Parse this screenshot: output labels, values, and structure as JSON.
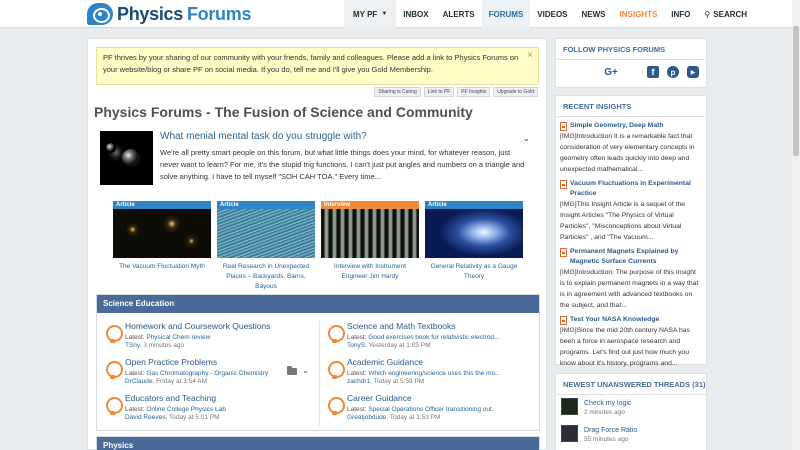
{
  "header": {
    "logo": {
      "part1": "Physics",
      "part2": "Forums"
    },
    "nav": [
      {
        "label": "MY PF",
        "id": "mypf"
      },
      {
        "label": "INBOX",
        "id": "inbox"
      },
      {
        "label": "ALERTS",
        "id": "alerts"
      },
      {
        "label": "FORUMS",
        "id": "forums"
      },
      {
        "label": "VIDEOS",
        "id": "videos"
      },
      {
        "label": "NEWS",
        "id": "news"
      },
      {
        "label": "INSIGHTS",
        "id": "insights"
      },
      {
        "label": "INFO",
        "id": "info"
      },
      {
        "label": "SEARCH",
        "id": "search"
      }
    ],
    "accent_insights": "#f0893a",
    "accent_forums": "#2d6fa5"
  },
  "notice": {
    "text": "PF thrives by your sharing of our community with your friends, family and colleagues. Please add a link to Physics Forums on your website/blog or share PF on social media. If you do, tell me and I'll give you Gold Membership.",
    "close": "×",
    "links": [
      "Sharing is Caring",
      "Link to PF",
      "PF Insights",
      "Upgrade to Gold"
    ]
  },
  "page_title": "Physics Forums - The Fusion of Science and Community",
  "featured_post": {
    "title": "What menial mental task do you struggle with?",
    "text": "We're all pretty smart people on this forum, but what little things does your mind, for whatever reason, just never want to learn? For me, it's the stupid trig functions. I can't just put angles and numbers on a triangle and solve anything. I have to tell myself \"SOH CAH TOA.\" Every time..."
  },
  "articles": [
    {
      "tag": "Article",
      "caption": "The Vacuum Fluctuation Myth"
    },
    {
      "tag": "Article",
      "caption": "Real Research in Unexpected Places – Backyards, Barns, Bayous"
    },
    {
      "tag": "Interview",
      "caption": "Interview with Instrument Engineer Jim Hardy"
    },
    {
      "tag": "Article",
      "caption": "General Relativity as a Gauge Theory"
    }
  ],
  "sections": [
    {
      "title": "Science Education",
      "forums": [
        {
          "title": "Homework and Coursework Questions",
          "latest_label": "Latest:",
          "latest": "Physical Chem review",
          "user": "TSny",
          "time": ", 3 minutes ago"
        },
        {
          "title": "Open Practice Problems",
          "latest_label": "Latest:",
          "latest": "Gas Chromatography - Organic Chemistry",
          "user": "DrClaude",
          "time": ", Friday at 3:54 AM"
        },
        {
          "title": "Educators and Teaching",
          "latest_label": "Latest:",
          "latest": "Online College Physics Lab",
          "user": "David Reeves",
          "time": ", Today at 5:01 PM"
        },
        {
          "title": "Science and Math Textbooks",
          "latest_label": "Latest:",
          "latest": "Good exercises book for relativistic electrod...",
          "user": "TonyS",
          "time": ", Yesterday at 1:03 PM"
        },
        {
          "title": "Academic Guidance",
          "latest_label": "Latest:",
          "latest": "Which engineering/science uses this the mo...",
          "user": "zachdr1",
          "time": ", Today at 5:59 PM"
        },
        {
          "title": "Career Guidance",
          "latest_label": "Latest:",
          "latest": "Special Operations Officer transitioning out.",
          "user": "Greatjobdude",
          "time": ", Today at 1:53 PM"
        }
      ]
    },
    {
      "title": "Physics"
    }
  ],
  "sidebar": {
    "follow": {
      "title": "FOLLOW PHYSICS FORUMS",
      "icons": [
        "apple-icon",
        "android-icon",
        "google-plus-icon",
        "twitter-icon",
        "facebook-icon",
        "pinterest-icon",
        "youtube-icon"
      ],
      "glyphs": [
        "",
        "",
        "G+",
        "",
        "f",
        "p",
        "▶"
      ]
    },
    "insights": {
      "title": "RECENT INSIGHTS",
      "items": [
        {
          "title": "Simple Geometry, Deep Math",
          "text": "[IMG]Introduction It is a remarkable fact that consideration of very elementary concepts in geometry often leads quickly into deep and unexpected mathematical..."
        },
        {
          "title": "Vacuum Fluctuations in Experimental Practice",
          "text": "[IMG]This Insight Article is a sequel of the Insight Articles \"The Physics of Virtual Particles\", \"Misconceptions about Virtual Particles\" , and \"The Vacuum..."
        },
        {
          "title": "Permanent Magnets Explained by Magnetic Surface Currents",
          "text": "[IMG]Introduction: The purpose of this Insight is to explain permanent magnets in a way that is in agreement with advanced textbooks on the subject, and that..."
        },
        {
          "title": "Test Your NASA Knowledge",
          "text": "[IMG]Since the mid 20th century NASA has been a force in aerospace research and programs. Let's find out just how much you know about it's history, programs and..."
        }
      ]
    },
    "threads": {
      "title": "NEWEST UNANSWERED THREADS (31)",
      "items": [
        {
          "title": "Check my logic",
          "time": "2 minutes ago"
        },
        {
          "title": "Drag Force Ratio",
          "time": "55 minutes ago"
        }
      ]
    }
  }
}
